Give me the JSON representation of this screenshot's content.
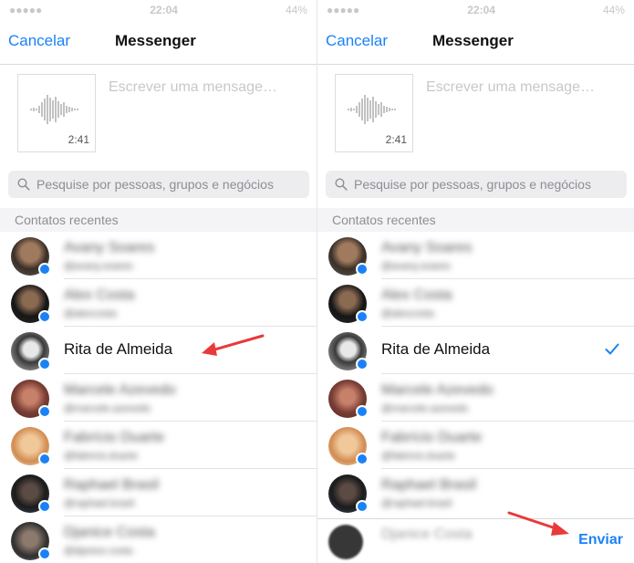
{
  "panels": [
    {
      "status": {
        "time": "22:04",
        "battery": "44%"
      },
      "nav": {
        "cancel": "Cancelar",
        "title": "Messenger"
      },
      "compose": {
        "duration": "2:41",
        "placeholder": "Escrever uma mensage…"
      },
      "search": {
        "placeholder": "Pesquise por pessoas, grupos e negócios"
      },
      "section": "Contatos recentes",
      "contacts": [
        {
          "name": "Avany Soares",
          "sub": "@avany.soares"
        },
        {
          "name": "Alex Costa",
          "sub": "@alexcosta"
        },
        {
          "name": "Rita de Almeida"
        },
        {
          "name": "Marcele Azevedo",
          "sub": "@marcele.azevedo"
        },
        {
          "name": "Fabrício Duarte",
          "sub": "@fabricio.duarte"
        },
        {
          "name": "Raphael Brasil",
          "sub": "@raphael.brasil"
        },
        {
          "name": "Djanice Costa",
          "sub": "@djanice.costa"
        }
      ]
    },
    {
      "status": {
        "time": "22:04",
        "battery": "44%"
      },
      "nav": {
        "cancel": "Cancelar",
        "title": "Messenger"
      },
      "compose": {
        "duration": "2:41",
        "placeholder": "Escrever uma mensage…"
      },
      "search": {
        "placeholder": "Pesquise por pessoas, grupos e negócios"
      },
      "section": "Contatos recentes",
      "contacts": [
        {
          "name": "Avany Soares",
          "sub": "@avany.soares"
        },
        {
          "name": "Alex Costa",
          "sub": "@alexcosta"
        },
        {
          "name": "Rita de Almeida",
          "selected": true
        },
        {
          "name": "Marcele Azevedo",
          "sub": "@marcele.azevedo"
        },
        {
          "name": "Fabrício Duarte",
          "sub": "@fabricio.duarte"
        },
        {
          "name": "Raphael Brasil",
          "sub": "@raphael.brasil"
        }
      ],
      "send_bar": {
        "under_name": "Djanice Costa",
        "send": "Enviar"
      }
    }
  ],
  "colors": {
    "accent": "#1a82f6",
    "annotation_arrow": "#e83a3a"
  }
}
